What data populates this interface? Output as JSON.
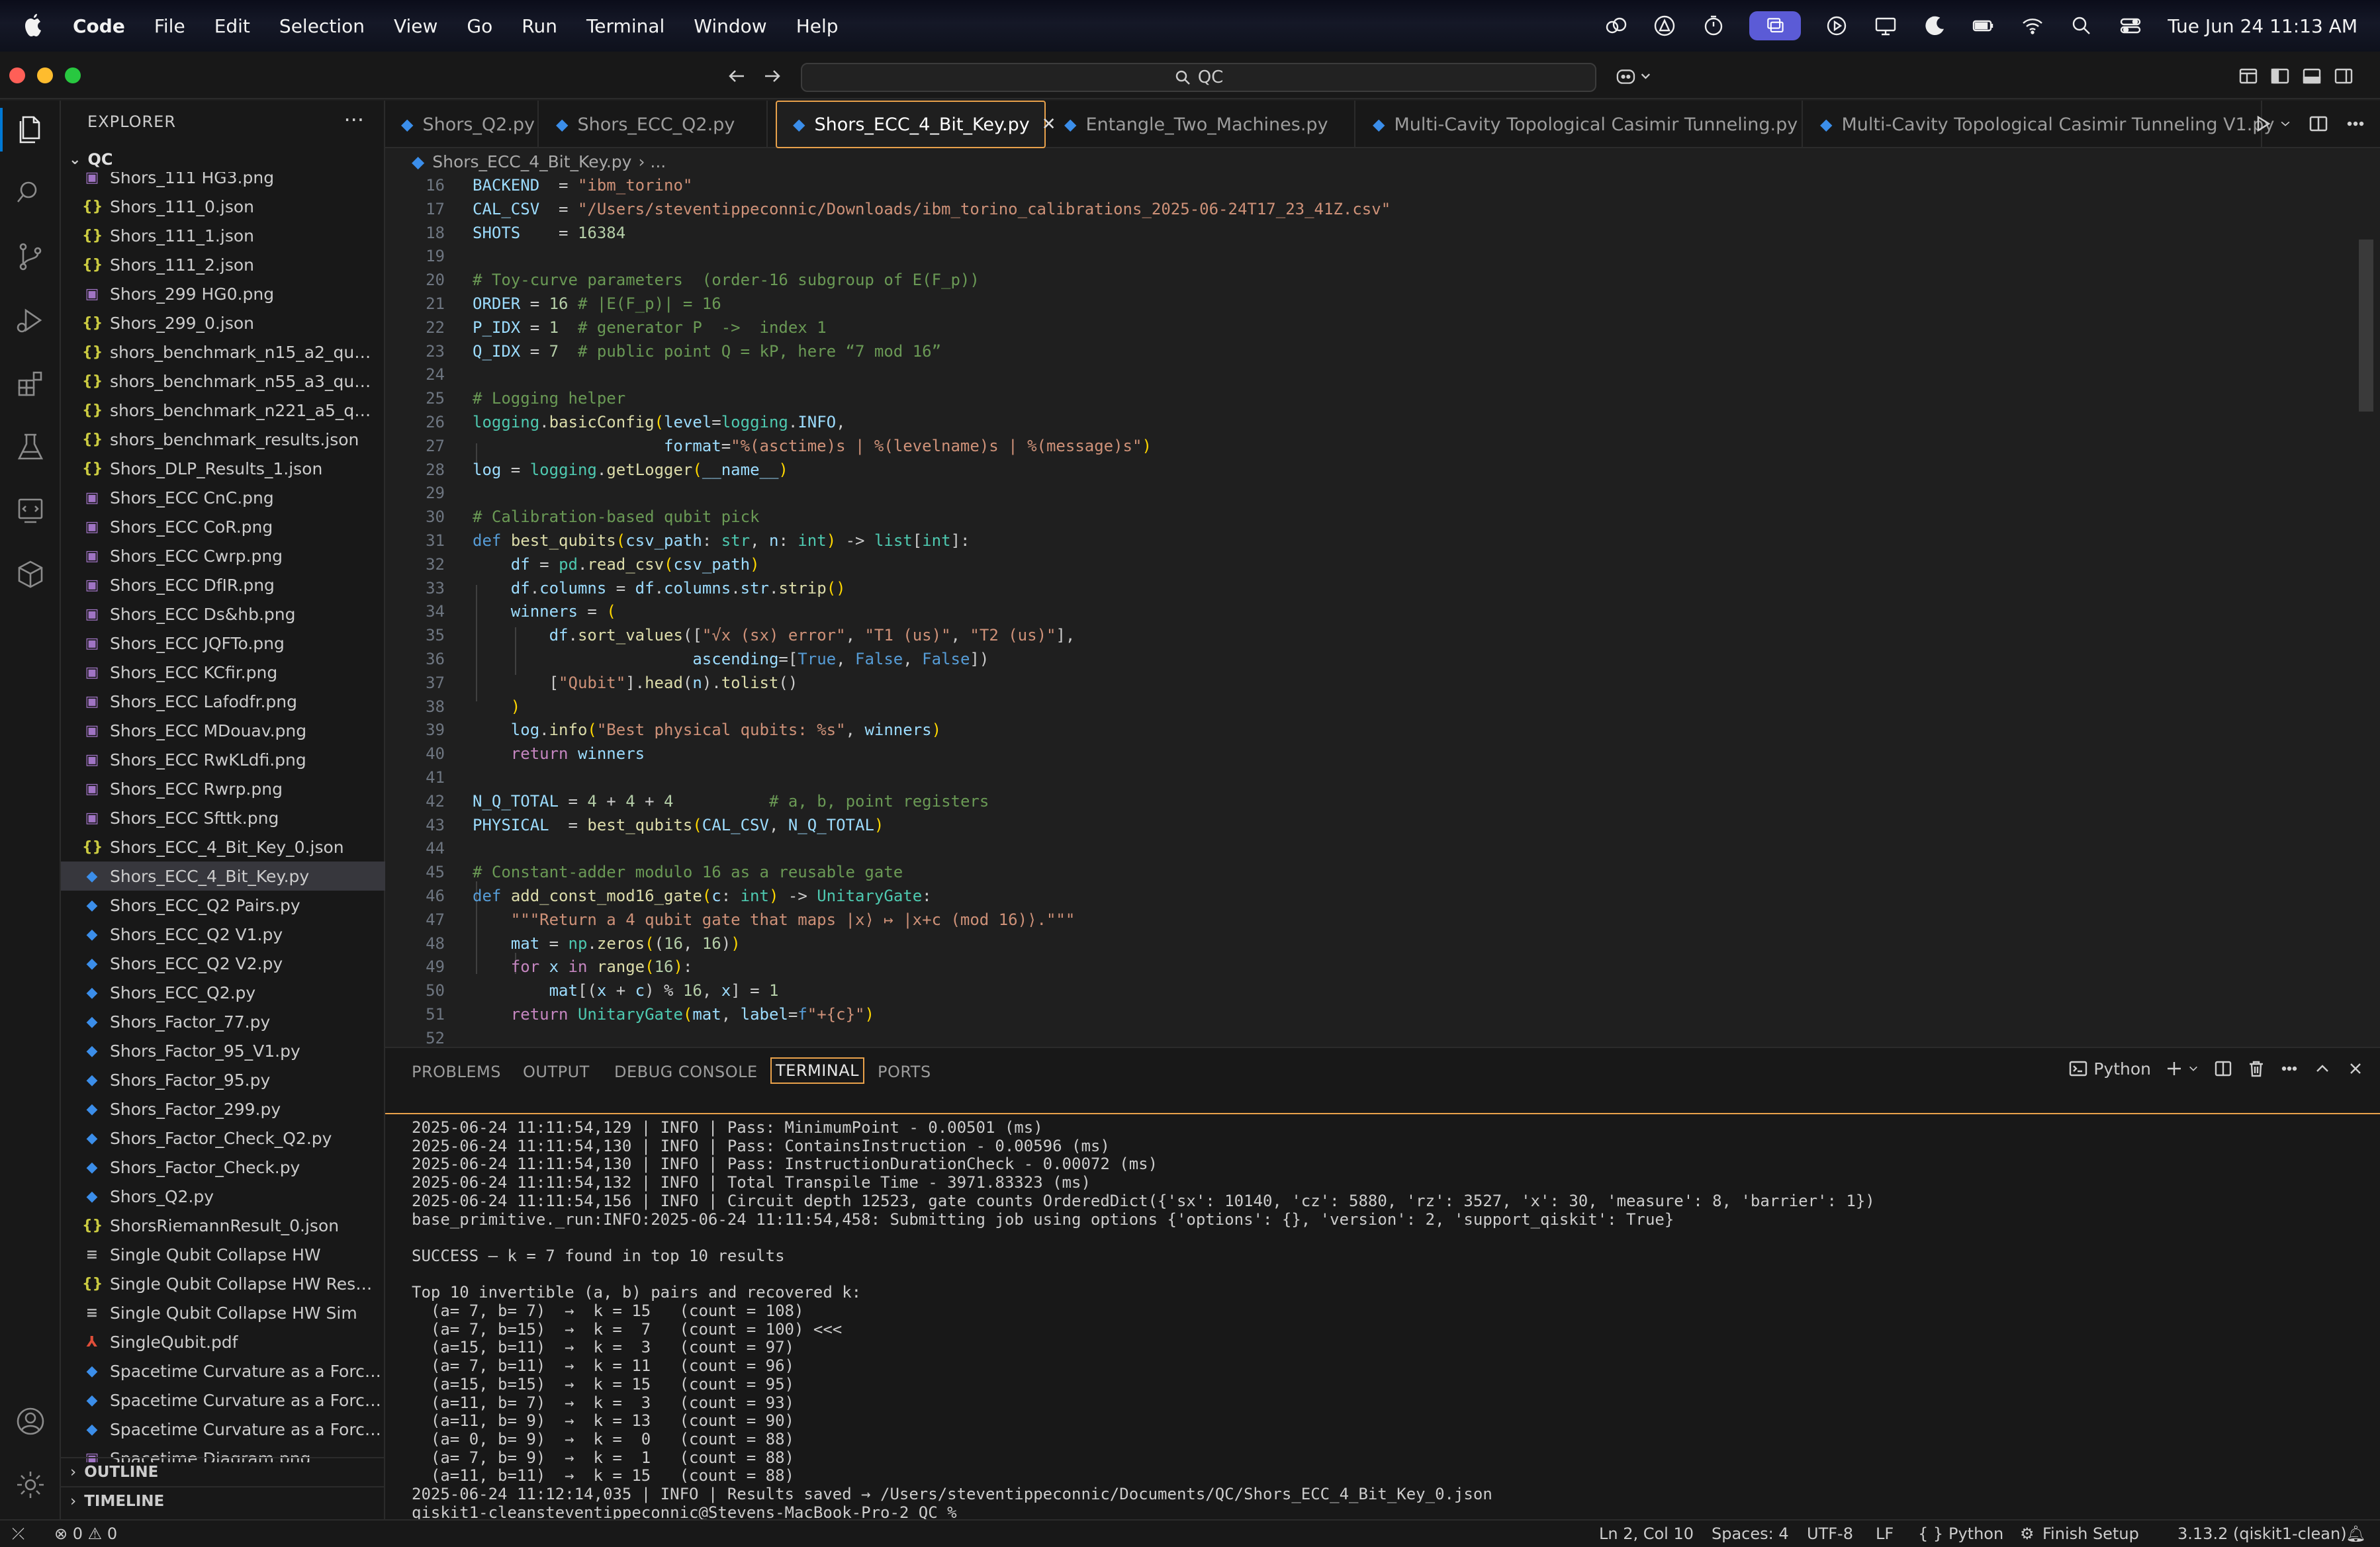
{
  "menubar": {
    "app": "Code",
    "menus": [
      "File",
      "Edit",
      "Selection",
      "View",
      "Go",
      "Run",
      "Terminal",
      "Window",
      "Help"
    ],
    "clock": "Tue Jun 24  11:13 AM"
  },
  "titlebar": {
    "command_center": "QC"
  },
  "sidebar": {
    "title": "EXPLORER",
    "more": "···",
    "root": "QC",
    "files": [
      {
        "name": "Shors_111 HG3.png",
        "type": "png"
      },
      {
        "name": "Shors_111_0.json",
        "type": "json"
      },
      {
        "name": "Shors_111_1.json",
        "type": "json"
      },
      {
        "name": "Shors_111_2.json",
        "type": "json"
      },
      {
        "name": "Shors_299 HG0.png",
        "type": "png"
      },
      {
        "name": "Shors_299_0.json",
        "type": "json"
      },
      {
        "name": "shors_benchmark_n15_a2_qubit...",
        "type": "json"
      },
      {
        "name": "shors_benchmark_n55_a3_qubi...",
        "type": "json"
      },
      {
        "name": "shors_benchmark_n221_a5_qub...",
        "type": "json"
      },
      {
        "name": "shors_benchmark_results.json",
        "type": "json"
      },
      {
        "name": "Shors_DLP_Results_1.json",
        "type": "json"
      },
      {
        "name": "Shors_ECC CnC.png",
        "type": "png"
      },
      {
        "name": "Shors_ECC CoR.png",
        "type": "png"
      },
      {
        "name": "Shors_ECC Cwrp.png",
        "type": "png"
      },
      {
        "name": "Shors_ECC DfIR.png",
        "type": "png"
      },
      {
        "name": "Shors_ECC Ds&hb.png",
        "type": "png"
      },
      {
        "name": "Shors_ECC JQFTo.png",
        "type": "png"
      },
      {
        "name": "Shors_ECC KCfir.png",
        "type": "png"
      },
      {
        "name": "Shors_ECC Lafodfr.png",
        "type": "png"
      },
      {
        "name": "Shors_ECC MDouav.png",
        "type": "png"
      },
      {
        "name": "Shors_ECC RwKLdfi.png",
        "type": "png"
      },
      {
        "name": "Shors_ECC Rwrp.png",
        "type": "png"
      },
      {
        "name": "Shors_ECC Sfttk.png",
        "type": "png"
      },
      {
        "name": "Shors_ECC_4_Bit_Key_0.json",
        "type": "json"
      },
      {
        "name": "Shors_ECC_4_Bit_Key.py",
        "type": "py"
      },
      {
        "name": "Shors_ECC_Q2 Pairs.py",
        "type": "py"
      },
      {
        "name": "Shors_ECC_Q2 V1.py",
        "type": "py"
      },
      {
        "name": "Shors_ECC_Q2 V2.py",
        "type": "py"
      },
      {
        "name": "Shors_ECC_Q2.py",
        "type": "py"
      },
      {
        "name": "Shors_Factor_77.py",
        "type": "py"
      },
      {
        "name": "Shors_Factor_95_V1.py",
        "type": "py"
      },
      {
        "name": "Shors_Factor_95.py",
        "type": "py"
      },
      {
        "name": "Shors_Factor_299.py",
        "type": "py"
      },
      {
        "name": "Shors_Factor_Check_Q2.py",
        "type": "py"
      },
      {
        "name": "Shors_Factor_Check.py",
        "type": "py"
      },
      {
        "name": "Shors_Q2.py",
        "type": "py"
      },
      {
        "name": "ShorsRiemannResult_0.json",
        "type": "json"
      },
      {
        "name": "Single Qubit Collapse HW",
        "type": "txt"
      },
      {
        "name": "Single Qubit Collapse HW Result...",
        "type": "json"
      },
      {
        "name": "Single Qubit Collapse HW Sim",
        "type": "txt"
      },
      {
        "name": "SingleQubit.pdf",
        "type": "pdf"
      },
      {
        "name": "Spacetime Curvature as a Force ...",
        "type": "py"
      },
      {
        "name": "Spacetime Curvature as a Force ...",
        "type": "py"
      },
      {
        "name": "Spacetime Curvature as a Force ...",
        "type": "py"
      },
      {
        "name": "Spacetime Diagram.png",
        "type": "png"
      }
    ],
    "selected_index": 24,
    "sections": [
      "OUTLINE",
      "TIMELINE"
    ]
  },
  "tabs": [
    {
      "label": "Shors_Q2.py",
      "active": false
    },
    {
      "label": "Shors_ECC_Q2.py",
      "active": false
    },
    {
      "label": "Shors_ECC_4_Bit_Key.py",
      "active": true
    },
    {
      "label": "Entangle_Two_Machines.py",
      "active": false
    },
    {
      "label": "Multi-Cavity Topological Casimir Tunneling.py",
      "active": false
    },
    {
      "label": "Multi-Cavity Topological Casimir Tunneling V1.py",
      "active": false
    }
  ],
  "breadcrumb": {
    "file": "Shors_ECC_4_Bit_Key.py",
    "rest": "› ..."
  },
  "editor": {
    "lines": [
      {
        "n": "16",
        "html": "<span class='v'>BACKEND</span>  = <span class='s'>\"ibm_torino\"</span>"
      },
      {
        "n": "17",
        "html": "<span class='v'>CAL_CSV</span>  = <span class='s'>\"/Users/steventippeconnic/Downloads/ibm_torino_calibrations_2025-06-24T17_23_41Z.csv\"</span>"
      },
      {
        "n": "18",
        "html": "<span class='v'>SHOTS</span>    = <span class='n'>16384</span>"
      },
      {
        "n": "19",
        "html": ""
      },
      {
        "n": "20",
        "html": "<span class='c'># Toy-curve parameters  (order-16 subgroup of E(F_p))</span>"
      },
      {
        "n": "21",
        "html": "<span class='v'>ORDER</span> = <span class='n'>16</span> <span class='c'># |E(F_p)| = 16</span>"
      },
      {
        "n": "22",
        "html": "<span class='v'>P_IDX</span> = <span class='n'>1</span>  <span class='c'># generator P  -&gt;  index 1</span>"
      },
      {
        "n": "23",
        "html": "<span class='v'>Q_IDX</span> = <span class='n'>7</span>  <span class='c'># public point Q = kP, here “7 mod 16”</span>"
      },
      {
        "n": "24",
        "html": ""
      },
      {
        "n": "25",
        "html": "<span class='c'># Logging helper</span>"
      },
      {
        "n": "26",
        "html": "<span class='t'>logging</span>.<span class='f'>basicConfig</span><span class='p'>(</span><span class='v'>level</span>=<span class='t'>logging</span>.<span class='v'>INFO</span>,"
      },
      {
        "n": "27",
        "html": "                    <span class='v'>format</span>=<span class='s'>\"%(asctime)s | %(levelname)s | %(message)s\"</span><span class='p'>)</span>"
      },
      {
        "n": "28",
        "html": "<span class='v'>log</span> = <span class='t'>logging</span>.<span class='f'>getLogger</span><span class='p'>(</span><span class='v'>__name__</span><span class='p'>)</span>"
      },
      {
        "n": "29",
        "html": ""
      },
      {
        "n": "30",
        "html": "<span class='c'># Calibration-based qubit pick</span>"
      },
      {
        "n": "31",
        "html": "<span class='kd'>def</span> <span class='f'>best_qubits</span><span class='p'>(</span><span class='v'>csv_path</span>: <span class='t'>str</span>, <span class='v'>n</span>: <span class='t'>int</span><span class='p'>)</span> -&gt; <span class='t'>list</span>[<span class='t'>int</span>]:"
      },
      {
        "n": "32",
        "html": "    <span class='v'>df</span> = <span class='t'>pd</span>.<span class='f'>read_csv</span><span class='p'>(</span><span class='v'>csv_path</span><span class='p'>)</span>"
      },
      {
        "n": "33",
        "html": "    <span class='v'>df</span>.<span class='v'>columns</span> = <span class='v'>df</span>.<span class='v'>columns</span>.<span class='v'>str</span>.<span class='f'>strip</span><span class='p'>()</span>"
      },
      {
        "n": "34",
        "html": "    <span class='v'>winners</span> = <span class='p'>(</span>"
      },
      {
        "n": "35",
        "html": "        <span class='v'>df</span>.<span class='f'>sort_values</span>([<span class='s'>\"√x (sx) error\"</span>, <span class='s'>\"T1 (us)\"</span>, <span class='s'>\"T2 (us)\"</span>],"
      },
      {
        "n": "36",
        "html": "                       <span class='v'>ascending</span>=[<span class='kd'>True</span>, <span class='kd'>False</span>, <span class='kd'>False</span>])"
      },
      {
        "n": "37",
        "html": "        [<span class='s'>\"Qubit\"</span>].<span class='f'>head</span>(<span class='v'>n</span>).<span class='f'>tolist</span>()"
      },
      {
        "n": "38",
        "html": "    <span class='p'>)</span>"
      },
      {
        "n": "39",
        "html": "    <span class='v'>log</span>.<span class='f'>info</span><span class='p'>(</span><span class='s'>\"Best physical qubits: %s\"</span>, <span class='v'>winners</span><span class='p'>)</span>"
      },
      {
        "n": "40",
        "html": "    <span class='k'>return</span> <span class='v'>winners</span>"
      },
      {
        "n": "41",
        "html": ""
      },
      {
        "n": "42",
        "html": "<span class='v'>N_Q_TOTAL</span> = <span class='n'>4</span> + <span class='n'>4</span> + <span class='n'>4</span>          <span class='c'># a, b, point registers</span>"
      },
      {
        "n": "43",
        "html": "<span class='v'>PHYSICAL</span>  = <span class='f'>best_qubits</span><span class='p'>(</span><span class='v'>CAL_CSV</span>, <span class='v'>N_Q_TOTAL</span><span class='p'>)</span>"
      },
      {
        "n": "44",
        "html": ""
      },
      {
        "n": "45",
        "html": "<span class='c'># Constant-adder modulo 16 as a reusable gate</span>"
      },
      {
        "n": "46",
        "html": "<span class='kd'>def</span> <span class='f'>add_const_mod16_gate</span><span class='p'>(</span><span class='v'>c</span>: <span class='t'>int</span><span class='p'>)</span> -&gt; <span class='t'>UnitaryGate</span>:"
      },
      {
        "n": "47",
        "html": "    <span class='s'>\"\"\"Return a 4 qubit gate that maps |x⟩ ↦ |x+c (mod 16)⟩.\"\"\"</span>"
      },
      {
        "n": "48",
        "html": "    <span class='v'>mat</span> = <span class='t'>np</span>.<span class='f'>zeros</span><span class='p'>(</span>(<span class='n'>16</span>, <span class='n'>16</span>)<span class='p'>)</span>"
      },
      {
        "n": "49",
        "html": "    <span class='k'>for</span> <span class='v'>x</span> <span class='k'>in</span> <span class='f'>range</span><span class='p'>(</span><span class='n'>16</span><span class='p'>)</span>:"
      },
      {
        "n": "50",
        "html": "        <span class='v'>mat</span>[(<span class='v'>x</span> + <span class='v'>c</span>) % <span class='n'>16</span>, <span class='v'>x</span>] = <span class='n'>1</span>"
      },
      {
        "n": "51",
        "html": "    <span class='k'>return</span> <span class='t'>UnitaryGate</span><span class='p'>(</span><span class='v'>mat</span>, <span class='v'>label</span>=<span class='kd'>f</span><span class='s'>\"+{c}\"</span><span class='p'>)</span>"
      },
      {
        "n": "52",
        "html": ""
      }
    ]
  },
  "panel": {
    "tabs": [
      "PROBLEMS",
      "OUTPUT",
      "DEBUG CONSOLE",
      "TERMINAL",
      "PORTS"
    ],
    "active_tab": "TERMINAL",
    "shell": "Python",
    "terminal_lines": [
      "2025-06-24 11:11:54,129 | INFO | Pass: MinimumPoint - 0.00501 (ms)",
      "2025-06-24 11:11:54,130 | INFO | Pass: ContainsInstruction - 0.00596 (ms)",
      "2025-06-24 11:11:54,130 | INFO | Pass: InstructionDurationCheck - 0.00072 (ms)",
      "2025-06-24 11:11:54,132 | INFO | Total Transpile Time - 3971.83323 (ms)",
      "2025-06-24 11:11:54,156 | INFO | Circuit depth 12523, gate counts OrderedDict({'sx': 10140, 'cz': 5880, 'rz': 3527, 'x': 30, 'measure': 8, 'barrier': 1})",
      "base_primitive._run:INFO:2025-06-24 11:11:54,458: Submitting job using options {'options': {}, 'version': 2, 'support_qiskit': True}",
      "",
      "SUCCESS — k = 7 found in top 10 results",
      "",
      "Top 10 invertible (a, b) pairs and recovered k:",
      "  (a= 7, b= 7)  →  k = 15   (count = 108)",
      "  (a= 7, b=15)  →  k =  7   (count = 100) <<<",
      "  (a=15, b=11)  →  k =  3   (count = 97)",
      "  (a= 7, b=11)  →  k = 11   (count = 96)",
      "  (a=15, b=15)  →  k = 15   (count = 95)",
      "  (a=11, b= 7)  →  k =  3   (count = 93)",
      "  (a=11, b= 9)  →  k = 13   (count = 90)",
      "  (a= 0, b= 9)  →  k =  0   (count = 88)",
      "  (a= 7, b= 9)  →  k =  1   (count = 88)",
      "  (a=11, b=11)  →  k = 15   (count = 88)",
      "2025-06-24 11:12:14,035 | INFO | Results saved → /Users/steventippeconnic/Documents/QC/Shors_ECC_4_Bit_Key_0.json",
      "qiskit1-cleansteventippeconnic@Stevens-MacBook-Pro-2 QC % "
    ]
  },
  "statusbar": {
    "errors": "0",
    "warnings": "0",
    "position": "Ln 2, Col 10",
    "spaces": "Spaces: 4",
    "encoding": "UTF-8",
    "eol": "LF",
    "language": "Python",
    "braces": "{ }",
    "finish_setup": "Finish Setup",
    "interpreter": "3.13.2 (qiskit1-clean)"
  },
  "colors": {
    "accent": "#0078d4",
    "tab_highlight": "#e8a14b",
    "json": "#cbcb41",
    "png": "#a074c4",
    "py": "#3b8eea"
  }
}
